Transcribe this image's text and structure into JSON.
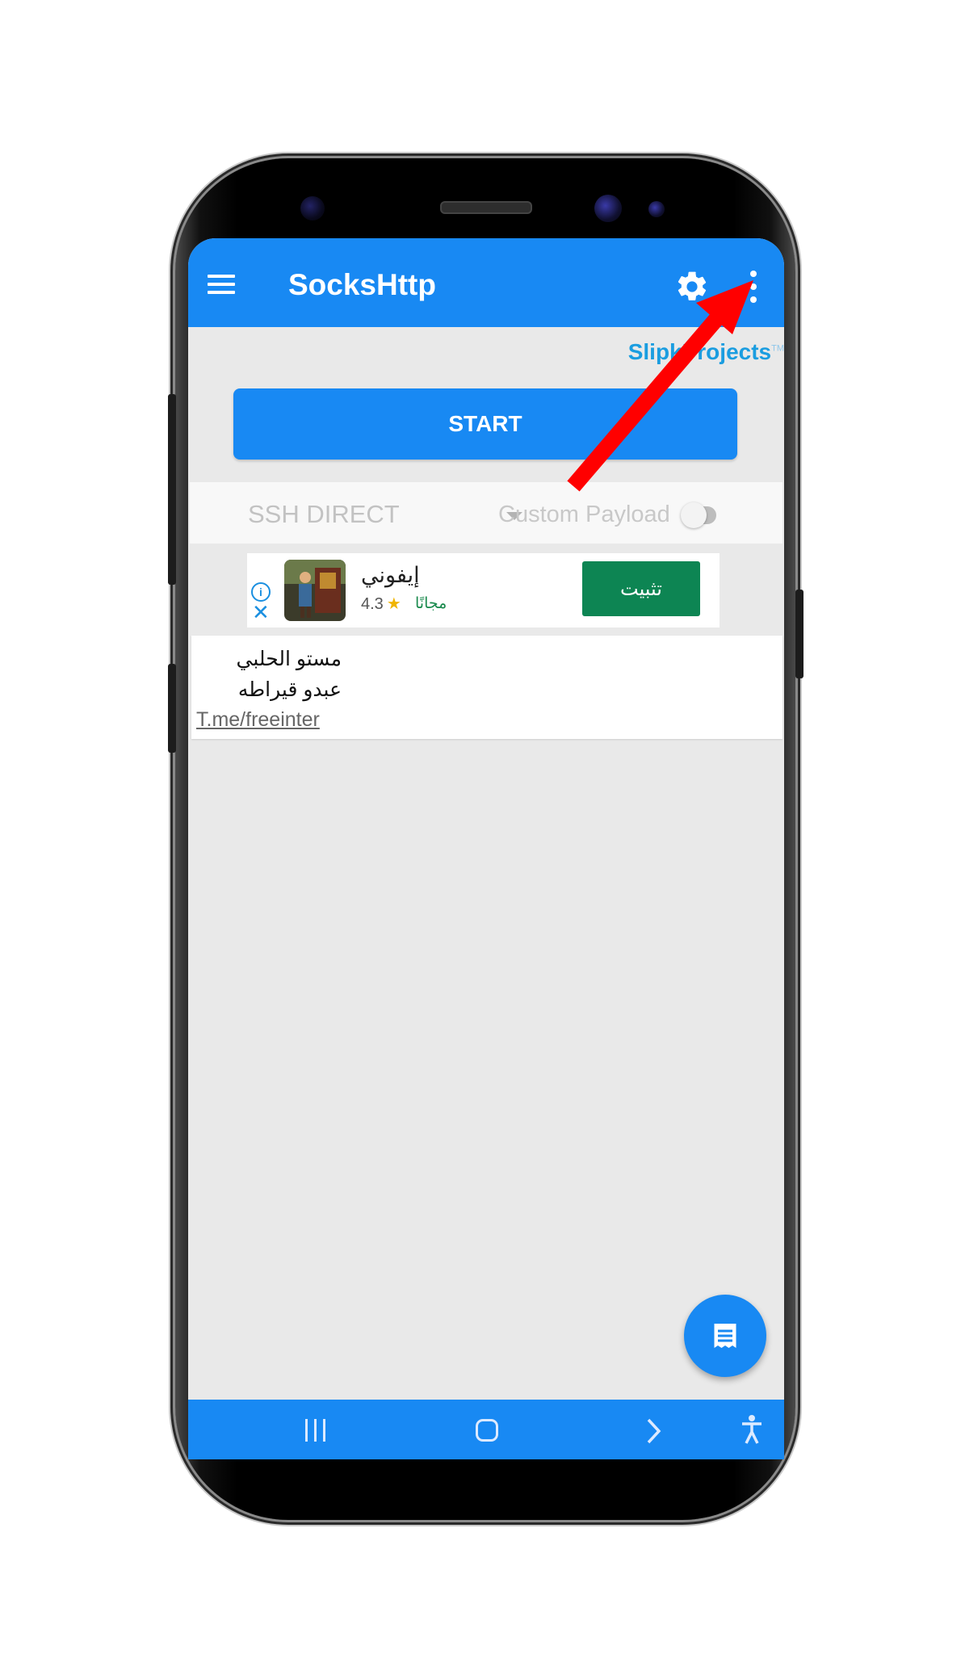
{
  "app": {
    "title": "SocksHttp",
    "brand": "SlipkProjects",
    "brand_tm": "TM",
    "start_label": "START",
    "mode": "SSH DIRECT",
    "payload_label": "Custom Payload",
    "payload_enabled": false
  },
  "ad": {
    "title": "إيفوني",
    "rating": "4.3",
    "price": "مجانًا",
    "install_label": "تثبيت",
    "info_icon": "info-icon",
    "close_icon": "close-icon"
  },
  "message": {
    "line1": "مستو الحلبي",
    "line2": "عبدو قيراطه",
    "link": "T.me/freeinter"
  },
  "icons": {
    "menu": "hamburger-menu-icon",
    "settings": "gear-icon",
    "overflow": "more-vert-icon",
    "fab": "log-icon",
    "nav_recent": "recent-apps-icon",
    "nav_home": "home-icon",
    "nav_back": "back-icon",
    "nav_accessibility": "accessibility-icon"
  },
  "colors": {
    "primary": "#1889f3",
    "install_button": "#0d8553",
    "brand_text": "#1a9de0",
    "annotation_arrow": "#ff0000"
  }
}
